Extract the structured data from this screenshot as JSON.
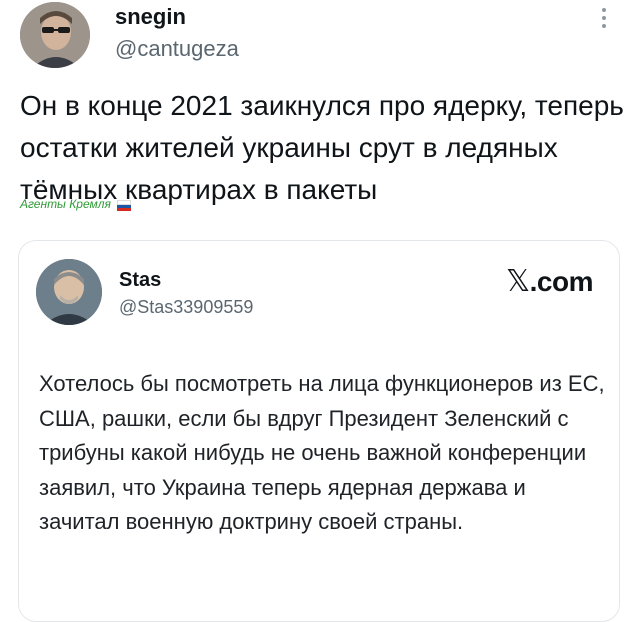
{
  "tweet": {
    "author_name": "snegin",
    "author_handle": "@cantugeza",
    "text": "Он в конце 2021 заикнулся про ядерку, теперь остатки жителей украины срут в ледяных тёмных квартирах в пакеты",
    "more_icon": "more-vertical-icon"
  },
  "watermark": {
    "text": "Агенты Кремля",
    "flag_colors": [
      "#ffffff",
      "#1c57a5",
      "#d52b1e"
    ]
  },
  "quoted": {
    "author_name": "Stas",
    "author_handle": "@Stas33909559",
    "source_label": ".com",
    "source_icon": "x-logo-icon",
    "text": "Хотелось бы посмотреть на лица функционеров из ЕС, США, рашки, если бы вдруг Президент Зеленский с трибуны какой нибудь не очень важной конференции заявил, что Украина теперь ядерная держава и зачитал военную доктрину своей страны."
  }
}
